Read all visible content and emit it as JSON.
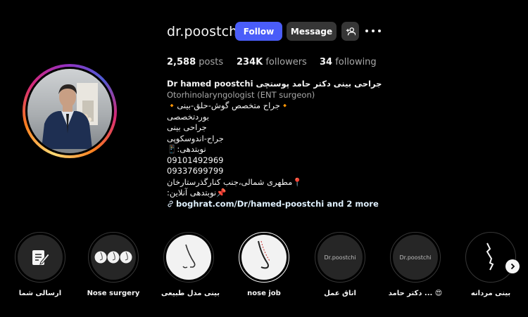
{
  "profile": {
    "username": "dr.poostchi",
    "follow_label": "Follow",
    "message_label": "Message",
    "suggest_icon": "person-plus-icon",
    "more_icon": "more-options-icon"
  },
  "stats": {
    "posts_count": "2,588",
    "posts_label": "posts",
    "followers_count": "234K",
    "followers_label": "followers",
    "following_count": "34",
    "following_label": "following"
  },
  "bio": {
    "name": "Dr hamed poostchi جراحی بینی دکتر حامد پوستچی",
    "category": "Otorhinolaryngologist (ENT surgeon)",
    "lines": [
      "🔸جراح متخصص گوش-حلق-بینی🔸",
      "بوردتخصصی",
      "جراحی بینی",
      "جراح-اندوسکوپی",
      "نوبتدهی:📱",
      "09101492969",
      "09337699799",
      "📍مطهری شمالی،جنب کنارگذرستارخان",
      "📌نوبتدهی آنلاین:"
    ],
    "link_text": "boghrat.com/Dr/hamed-poostchi and 2 more",
    "link_icon": "link-icon"
  },
  "highlights": [
    {
      "label": "ارسالی شما",
      "icon": "edit-note-icon"
    },
    {
      "label": "Nose surgery",
      "icon": "nose-profiles-icon"
    },
    {
      "label": "بینی مدل طبیعی",
      "icon": "nose-sketch-icon"
    },
    {
      "label": "nose job",
      "icon": "nose-line-icon"
    },
    {
      "label": "اتاق عمل",
      "inner_text": "Dr.poostchi"
    },
    {
      "label": "دکتر حامد ... 😍",
      "inner_text": "Dr.poostchi"
    },
    {
      "label": "بینی مردانه",
      "icon": "nose-outline-icon"
    }
  ],
  "colors": {
    "follow_button": "#4a5df9",
    "secondary_button": "#363636",
    "background": "#000000"
  }
}
